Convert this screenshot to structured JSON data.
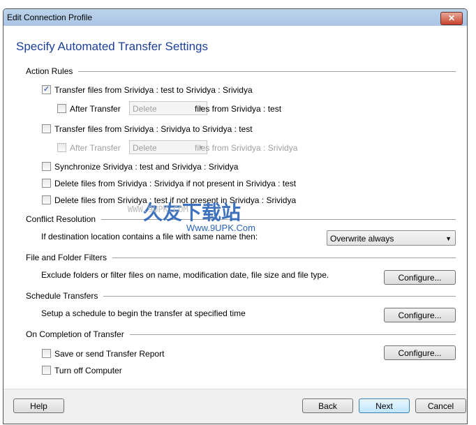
{
  "window": {
    "title": "Edit Connection Profile",
    "close": "✕"
  },
  "heading": "Specify Automated Transfer Settings",
  "sections": {
    "action_rules": "Action Rules",
    "conflict": "Conflict Resolution",
    "filters": "File and Folder Filters",
    "schedule": "Schedule Transfers",
    "completion": "On Completion of Transfer"
  },
  "action_rules": {
    "rule1": {
      "label": "Transfer files from Srividya : test to Srividya : Srividya",
      "checked": true
    },
    "after1": {
      "label": "After Transfer",
      "select": "Delete",
      "suffix": "files from Srividya : test",
      "checked": false
    },
    "rule2": {
      "label": "Transfer files from Srividya : Srividya to Srividya : test",
      "checked": false
    },
    "after2": {
      "label": "After Transfer",
      "select": "Delete",
      "suffix": "files from Srividya : Srividya",
      "checked": false
    },
    "sync": {
      "label": "Synchronize Srividya : test and Srividya : Srividya",
      "checked": false
    },
    "del1": {
      "label": "Delete files from Srividya : Srividya if not present in Srividya : test",
      "checked": false
    },
    "del2": {
      "label": "Delete files from Srividya : test if not present in Srividya : Srividya",
      "checked": false
    }
  },
  "conflict": {
    "label": "If destination location contains a file with same name then:",
    "value": "Overwrite always"
  },
  "filters": {
    "text": "Exclude folders or filter files on name, modification date, file size and file type.",
    "button": "Configure..."
  },
  "schedule": {
    "text": "Setup a schedule to begin the transfer at specified time",
    "button": "Configure..."
  },
  "completion": {
    "report": "Save or send Transfer Report",
    "shutdown": "Turn off Computer",
    "button": "Configure..."
  },
  "footer": {
    "help": "Help",
    "back": "Back",
    "next": "Next",
    "cancel": "Cancel"
  },
  "watermark": {
    "text": "久友下载站",
    "url": "Www.9UPK.Com",
    "url2": "WWW.9UPK.COM"
  }
}
